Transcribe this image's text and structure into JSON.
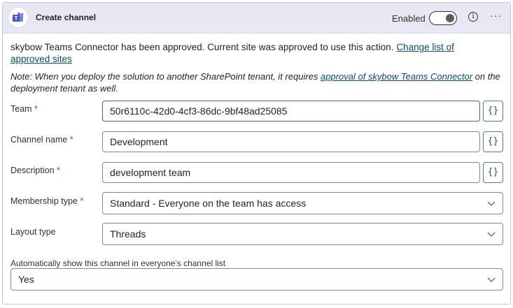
{
  "header": {
    "title": "Create channel",
    "enabled_label": "Enabled",
    "info_glyph": "i",
    "more_glyph": "···"
  },
  "messages": {
    "approved_text": "skybow Teams Connector has been approved. Current site was approved to use this action. ",
    "approved_link": "Change list of approved sites",
    "note_prefix": "Note: When you deploy the solution to another SharePoint tenant, it requires ",
    "note_link": "approval of skybow Teams Connector",
    "note_suffix": " on the deployment tenant as well."
  },
  "form": {
    "required_mark": "*",
    "braces": "{}",
    "team": {
      "label": "Team",
      "value": "50r6110c-42d0-4cf3-86dc-9bf48ad25085"
    },
    "channel_name": {
      "label": "Channel name",
      "value": "Development"
    },
    "description": {
      "label": "Description",
      "value": "development team"
    },
    "membership_type": {
      "label": "Membership type",
      "value": "Standard - Everyone on the team has access"
    },
    "layout_type": {
      "label": "Layout type",
      "value": "Threads"
    },
    "auto_show": {
      "label": "Automatically show this channel in everyone's channel list",
      "value": "Yes"
    }
  },
  "colors": {
    "header_bg": "#e7e8f4",
    "link": "#0e4b60",
    "required": "#c4314b",
    "teams_purple": "#5b5fc7"
  },
  "toggle": {
    "enabled": true
  }
}
